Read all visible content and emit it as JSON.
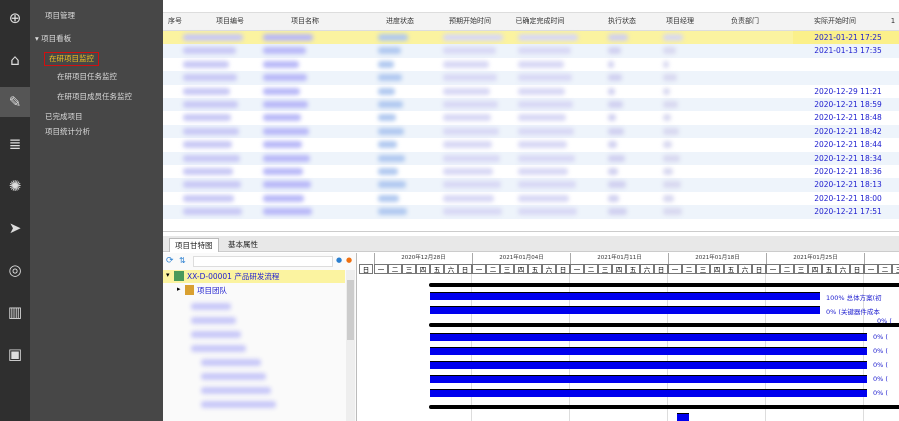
{
  "iconbar": [
    "search-icon",
    "home-icon",
    "edit-icon",
    "database-icon",
    "loading-icon",
    "send-icon",
    "target-icon",
    "book-icon",
    "id-card-icon"
  ],
  "nav": {
    "items": [
      {
        "label": "项目管理"
      },
      {
        "label": "▾ 项目看板"
      },
      {
        "label": "在研项目监控",
        "selected": true
      },
      {
        "label": "在研项目任务监控"
      },
      {
        "label": "在研项目成员任务监控"
      },
      {
        "label": "已完成项目"
      },
      {
        "label": "项目统计分析"
      }
    ]
  },
  "table": {
    "columns": [
      "序号",
      "项目编号",
      "项目名称",
      "进度状态",
      "预期开始时间",
      "已确定完成时间",
      "执行状态",
      "项目经理",
      "负责部门",
      "实际开始时间",
      "1"
    ],
    "actual_start": [
      "2021-01-21 17:25",
      "2021-01-13 17:35",
      "",
      "",
      "2020-12-29 11:21",
      "2020-12-21 18:59",
      "2020-12-21 18:48",
      "2020-12-21 18:42",
      "2020-12-21 18:44",
      "2020-12-21 18:34",
      "2020-12-21 18:36",
      "2020-12-21 18:13",
      "2020-12-21 18:00",
      "2020-12-21 17:51"
    ],
    "highlight_color": "#fbf3a0"
  },
  "tabs": [
    "项目甘特图",
    "基本属性"
  ],
  "tree": {
    "root": "XX-D-00001 产品研发流程",
    "child": "项目团队"
  },
  "gantt": {
    "weeks": [
      "2020年12月28日",
      "2021年01月04日",
      "2021年01月11日",
      "2021年01月18日",
      "2021年01月25日",
      "2021年"
    ],
    "days": [
      "日",
      "一",
      "二",
      "三",
      "四",
      "五",
      "六"
    ],
    "labels": [
      "100% 总体方案(初",
      "0% (关键器件成本",
      "0% (",
      "0% (",
      "0% (",
      "0% (",
      "0% (",
      "0% ("
    ]
  }
}
